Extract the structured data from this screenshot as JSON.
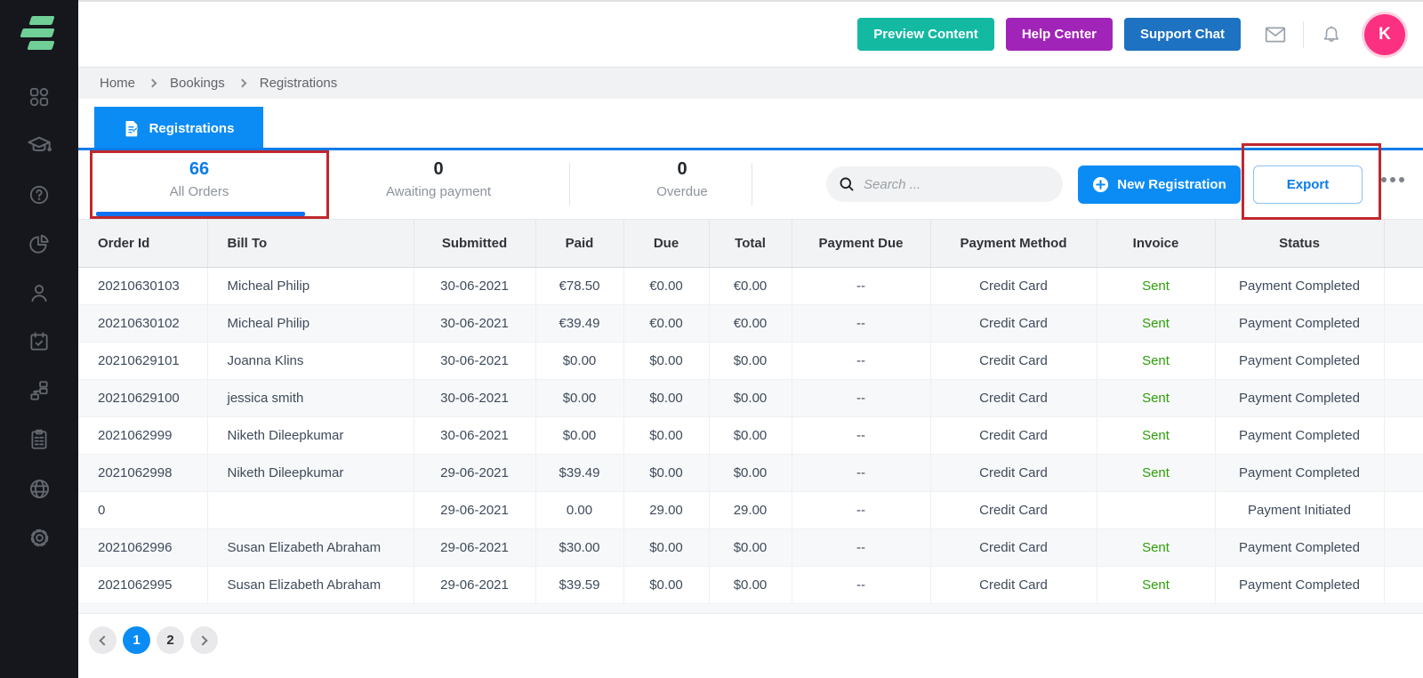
{
  "topbar": {
    "buttons": [
      {
        "label": "Preview Content",
        "color": "#14b9a2"
      },
      {
        "label": "Help Center",
        "color": "#a124b8"
      },
      {
        "label": "Support Chat",
        "color": "#1e72c2"
      }
    ],
    "icons": [
      "mail-icon",
      "bell-icon"
    ],
    "avatar_initial": "K",
    "avatar_color": "#fb3080"
  },
  "breadcrumb": {
    "items": [
      "Home",
      "Bookings",
      "Registrations"
    ]
  },
  "page_tab": {
    "label": "Registrations"
  },
  "stats": [
    {
      "value": "66",
      "label": "All Orders",
      "active": true
    },
    {
      "value": "0",
      "label": "Awaiting payment",
      "active": false
    },
    {
      "value": "0",
      "label": "Overdue",
      "active": false
    }
  ],
  "toolbar": {
    "search_placeholder": "Search ...",
    "new_registration_label": "New Registration",
    "export_label": "Export"
  },
  "annotations": [
    {
      "shape": "red-box",
      "target": "all-orders-stat",
      "color": "#c1272d"
    },
    {
      "shape": "red-box",
      "target": "export-button",
      "color": "#c1272d"
    }
  ],
  "table": {
    "columns": [
      "Order Id",
      "Bill To",
      "Submitted",
      "Paid",
      "Due",
      "Total",
      "Payment Due",
      "Payment Method",
      "Invoice",
      "Status"
    ],
    "column_keys": [
      "order-id",
      "bill-to",
      "submitted",
      "paid",
      "due",
      "total",
      "payment-due",
      "payment-method",
      "invoice",
      "status"
    ],
    "rows": [
      {
        "cells": [
          "20210630103",
          "Micheal Philip",
          "30-06-2021",
          "€78.50",
          "€0.00",
          "€0.00",
          "--",
          "Credit Card",
          "Sent",
          "Payment Completed"
        ]
      },
      {
        "cells": [
          "20210630102",
          "Micheal Philip",
          "30-06-2021",
          "€39.49",
          "€0.00",
          "€0.00",
          "--",
          "Credit Card",
          "Sent",
          "Payment Completed"
        ]
      },
      {
        "cells": [
          "20210629101",
          "Joanna Klins",
          "30-06-2021",
          "$0.00",
          "$0.00",
          "$0.00",
          "--",
          "Credit Card",
          "Sent",
          "Payment Completed"
        ]
      },
      {
        "cells": [
          "20210629100",
          "jessica smith",
          "30-06-2021",
          "$0.00",
          "$0.00",
          "$0.00",
          "--",
          "Credit Card",
          "Sent",
          "Payment Completed"
        ]
      },
      {
        "cells": [
          "2021062999",
          "Niketh Dileepkumar",
          "30-06-2021",
          "$0.00",
          "$0.00",
          "$0.00",
          "--",
          "Credit Card",
          "Sent",
          "Payment Completed"
        ]
      },
      {
        "cells": [
          "2021062998",
          "Niketh Dileepkumar",
          "29-06-2021",
          "$39.49",
          "$0.00",
          "$0.00",
          "--",
          "Credit Card",
          "Sent",
          "Payment Completed"
        ]
      },
      {
        "cells": [
          "0",
          "",
          "29-06-2021",
          "0.00",
          "29.00",
          "29.00",
          "--",
          "Credit Card",
          "",
          "Payment Initiated"
        ]
      },
      {
        "cells": [
          "2021062996",
          "Susan Elizabeth Abraham",
          "29-06-2021",
          "$30.00",
          "$0.00",
          "$0.00",
          "--",
          "Credit Card",
          "Sent",
          "Payment Completed"
        ]
      },
      {
        "cells": [
          "2021062995",
          "Susan Elizabeth Abraham",
          "29-06-2021",
          "$39.59",
          "$0.00",
          "$0.00",
          "--",
          "Credit Card",
          "Sent",
          "Payment Completed"
        ]
      }
    ],
    "invoice_sent_color": "#2f9e0b"
  },
  "pagination": {
    "pages": [
      "1",
      "2"
    ],
    "active_page": "1"
  },
  "colors": {
    "accent_blue": "#0b8cf5",
    "sidebar_bg": "#15171c",
    "logo_green": "#6fcf97",
    "annotation_red": "#c1272d"
  }
}
